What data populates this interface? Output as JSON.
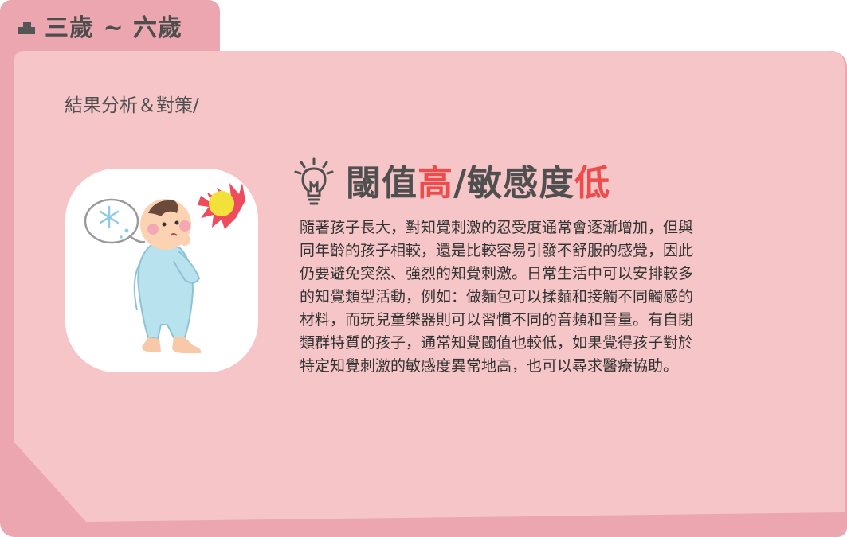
{
  "tab": {
    "icon": "shape-icon",
    "title": "三歲 ~ 六歲"
  },
  "section": {
    "subtitle": "結果分析＆對策/"
  },
  "heading": {
    "icon": "lightbulb-icon",
    "part1": "閾值",
    "part2": "高",
    "part3": "/敏感度",
    "part4": "低"
  },
  "body": {
    "lines": [
      "隨著孩子長大，對知覺刺激的忍受度通常會逐漸增加，但與",
      "同年齡的孩子相較，還是比較容易引發不舒服的感覺，因此",
      "仍要避免突然、強烈的知覺刺激。日常生活中可以安排較多",
      "的知覺類型活動，例如：做麵包可以揉麵和接觸不同觸感的",
      "材料，而玩兒童樂器則可以習慣不同的音頻和音量。有自閉",
      "類群特質的孩子，通常知覺閾值也較低，如果覺得孩子對於",
      "特定知覺刺激的敏感度異常地高，也可以尋求醫療協助。"
    ]
  },
  "illustration": {
    "icon": "baby-sensory-illustration",
    "thought_icon": "snowflake-icon",
    "sun_icon": "sun-icon"
  },
  "colors": {
    "card": "#f5c5c7",
    "border": "#eba6b0",
    "accent_red": "#ef4b4b",
    "text_dark": "#4f4f4f"
  }
}
